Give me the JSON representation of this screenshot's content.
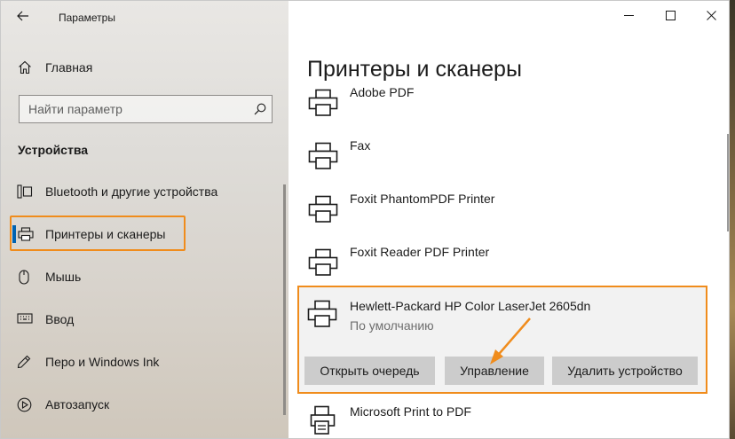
{
  "window": {
    "app_title": "Параметры",
    "controls": [
      "minimize",
      "maximize",
      "close"
    ]
  },
  "sidebar": {
    "home_label": "Главная",
    "search_placeholder": "Найти параметр",
    "section_title": "Устройства",
    "items": [
      {
        "label": "Bluetooth и другие устройства",
        "icon": "bluetooth-devices-icon"
      },
      {
        "label": "Принтеры и сканеры",
        "icon": "printer-icon",
        "selected": true
      },
      {
        "label": "Мышь",
        "icon": "mouse-icon"
      },
      {
        "label": "Ввод",
        "icon": "keyboard-icon"
      },
      {
        "label": "Перо и Windows Ink",
        "icon": "pen-icon"
      },
      {
        "label": "Автозапуск",
        "icon": "autoplay-icon"
      }
    ]
  },
  "main": {
    "page_title": "Принтеры и сканеры",
    "printers": [
      {
        "name": "Adobe PDF"
      },
      {
        "name": "Fax"
      },
      {
        "name": "Foxit PhantomPDF Printer"
      },
      {
        "name": "Foxit Reader PDF Printer"
      },
      {
        "name": "Hewlett-Packard HP Color LaserJet 2605dn",
        "status": "По умолчанию",
        "expanded": true
      },
      {
        "name": "Microsoft Print to PDF"
      }
    ],
    "actions": {
      "open_queue": "Открыть очередь",
      "manage": "Управление",
      "remove": "Удалить устройство"
    }
  },
  "colors": {
    "highlight": "#f08c1c",
    "accent": "#0063b1",
    "button_bg": "#cccccc"
  }
}
